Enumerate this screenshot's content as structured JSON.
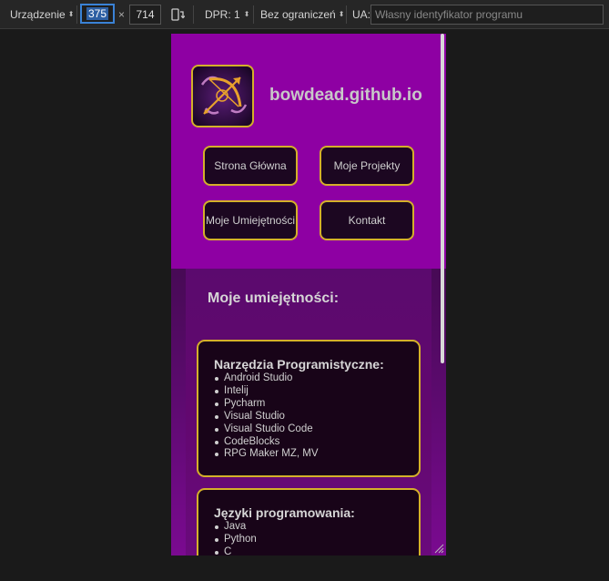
{
  "toolbar": {
    "device_label": "Urządzenie",
    "width_value": "375",
    "times": "×",
    "height_value": "714",
    "dpr_label": "DPR: 1",
    "throttle_label": "Bez ograniczeń",
    "ua_label": "UA:",
    "ua_placeholder": "Własny identyfikator programu",
    "icons": [
      "rotate-icon",
      "caret-icon"
    ]
  },
  "site": {
    "title": "bowdead.github.io",
    "logo_icon": "bow-arrow-logo",
    "nav": [
      {
        "label": "Strona Główna"
      },
      {
        "label": "Moje Projekty"
      },
      {
        "label": "Moje Umiejętności"
      },
      {
        "label": "Kontakt"
      }
    ]
  },
  "skills": {
    "section_title": "Moje umiejętności:",
    "cards": [
      {
        "title": "Narzędzia Programistyczne:",
        "items": [
          "Android Studio",
          "Intelij",
          "Pycharm",
          "Visual Studio",
          "Visual Studio Code",
          "CodeBlocks",
          "RPG Maker MZ, MV"
        ]
      },
      {
        "title": "Języki programowania:",
        "items": [
          "Java",
          "Python",
          "C"
        ]
      }
    ]
  },
  "colors": {
    "header": "#8e00a3",
    "accent_border": "#d4b02a",
    "button_bg": "#1c0721",
    "card_bg": "#180418"
  }
}
